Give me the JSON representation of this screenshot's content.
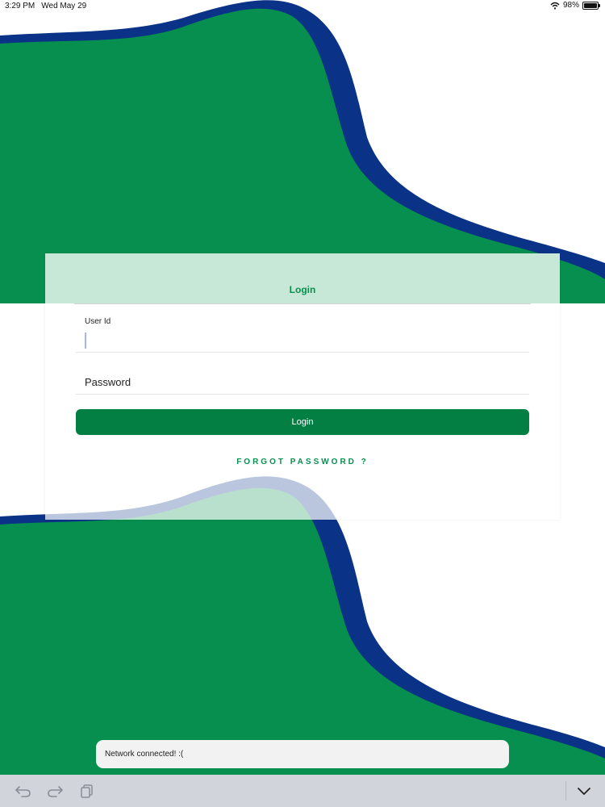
{
  "status_bar": {
    "time": "3:29 PM",
    "date": "Wed May 29",
    "battery_percent": "98%",
    "battery_level": 0.98,
    "wifi_icon": "wifi-icon"
  },
  "colors": {
    "brand_green": "#068f4e",
    "button_green": "#037f43",
    "wave_blue": "#0a3286",
    "header_mint": "#c8e8d7"
  },
  "login_card": {
    "title": "Login",
    "user_id_label": "User Id",
    "user_id_value": "",
    "password_placeholder": "Password",
    "password_value": "",
    "login_button_label": "Login",
    "forgot_password_label": "FORGOT PASSWORD ?"
  },
  "toast": {
    "message": "Network connected! :("
  },
  "keyboard_toolbar": {
    "icons": [
      "undo-icon",
      "redo-icon",
      "copy-icon",
      "chevron-down-icon"
    ]
  }
}
